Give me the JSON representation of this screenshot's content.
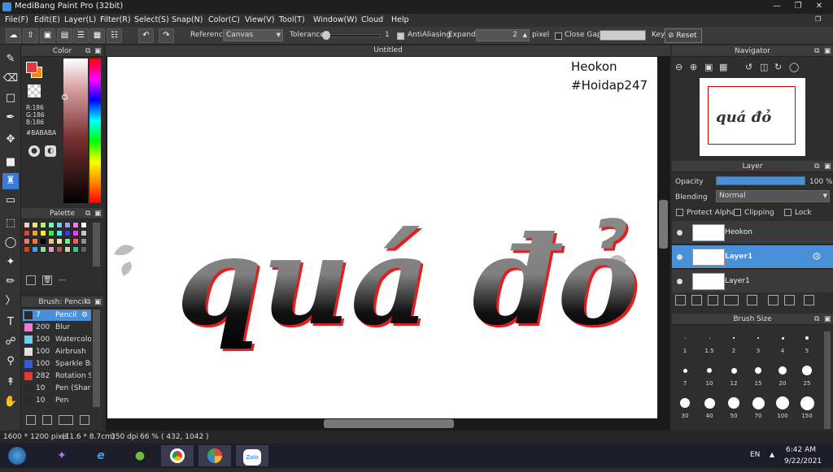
{
  "app": {
    "title": "MediBang Paint Pro (32bit)"
  },
  "menu": [
    "File(F)",
    "Edit(E)",
    "Layer(L)",
    "Filter(R)",
    "Select(S)",
    "Snap(N)",
    "Color(C)",
    "View(V)",
    "Tool(T)",
    "Window(W)",
    "Cloud",
    "Help"
  ],
  "toolbar": {
    "reference_label": "Reference",
    "reference_value": "Canvas",
    "tolerance_label": "Tolerance",
    "tolerance_value": "1",
    "antialiasing_label": "AntiAliasing",
    "expand_label": "Expand",
    "expand_value": "2",
    "expand_unit": "pixel",
    "close_gaps_label": "Close Gaps",
    "key_label": "Key",
    "reset_label": "Reset"
  },
  "color_panel": {
    "title": "Color",
    "r": "R:186",
    "g": "G:186",
    "b": "B:186",
    "hex": "#BABABA"
  },
  "palette_panel": {
    "title": "Palette",
    "extra": "---"
  },
  "brush_panel": {
    "title": "Brush: Pencil",
    "items": [
      {
        "size": "7",
        "name": "Pencil",
        "color": "#2a2a2a"
      },
      {
        "size": "200",
        "name": "Blur",
        "color": "#e87ed4"
      },
      {
        "size": "100",
        "name": "Watercolor",
        "color": "#6bd0f0"
      },
      {
        "size": "100",
        "name": "Airbrush",
        "color": "#e0e0e0"
      },
      {
        "size": "100",
        "name": "Sparkle Brush",
        "color": "#2f5bd6"
      },
      {
        "size": "282",
        "name": "Rotation Sym",
        "color": "#e03a3a"
      },
      {
        "size": "10",
        "name": "Pen (Sharp)",
        "color": "#2a2a2a"
      },
      {
        "size": "10",
        "name": "Pen",
        "color": "#2a2a2a"
      }
    ]
  },
  "canvas": {
    "tab": "Untitled",
    "watermark1": "Heokon",
    "watermark2": "#Hoidap247",
    "art_text": "quá đỏ"
  },
  "navigator": {
    "title": "Navigator"
  },
  "layer_panel": {
    "title": "Layer",
    "opacity_label": "Opacity",
    "opacity_value": "100 %",
    "blending_label": "Blending",
    "blending_value": "Normal",
    "protect_alpha": "Protect Alpha",
    "clipping": "Clipping",
    "lock": "Lock",
    "layers": [
      {
        "name": "Heokon"
      },
      {
        "name": "Layer1"
      },
      {
        "name": "Layer1"
      }
    ]
  },
  "brush_size": {
    "title": "Brush Size",
    "sizes": [
      "1",
      "1.5",
      "2",
      "3",
      "4",
      "5",
      "7",
      "10",
      "12",
      "15",
      "20",
      "25",
      "30",
      "40",
      "50",
      "70",
      "100",
      "150"
    ]
  },
  "status": {
    "dims": "1600 * 1200 pixel",
    "cm": "(11.6 * 8.7cm)",
    "dpi": "350 dpi",
    "zoom": "66 %",
    "coords": "( 432, 1042 )"
  },
  "taskbar": {
    "lang": "EN",
    "time": "6:42 AM",
    "date": "9/22/2021",
    "zalo": "Zalo"
  },
  "colors": {
    "accent": "#4a90d9",
    "primary_swatch": "#e03a3a",
    "secondary_swatch": "#f08a10"
  }
}
